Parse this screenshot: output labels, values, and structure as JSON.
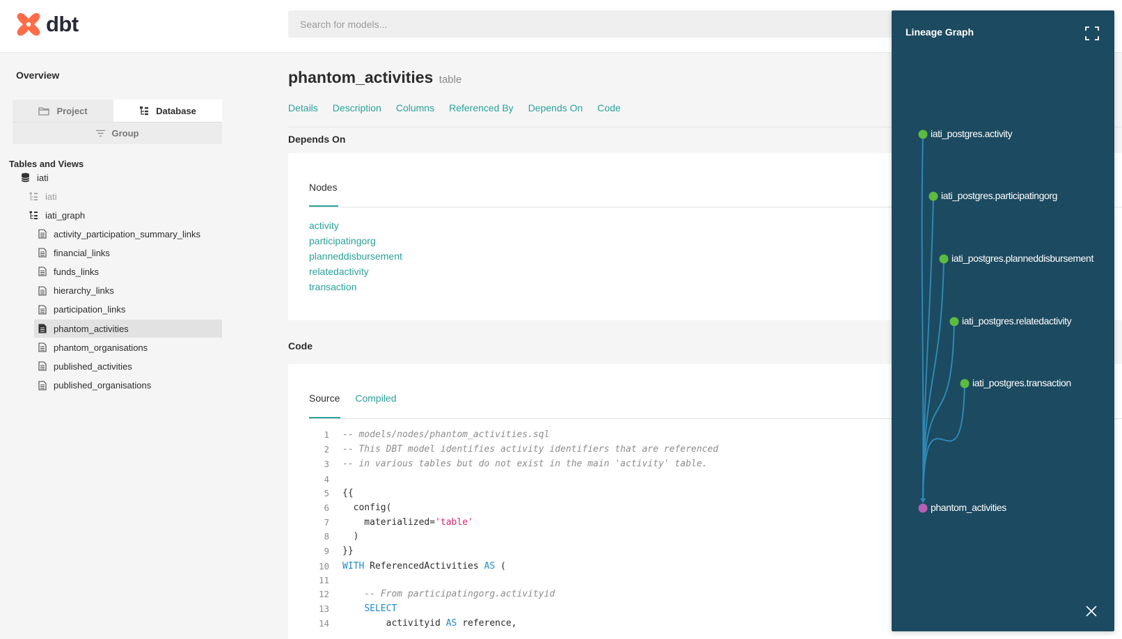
{
  "header": {
    "logo_text": "dbt",
    "search_placeholder": "Search for models..."
  },
  "sidebar": {
    "overview": "Overview",
    "switcher": {
      "project": "Project",
      "database": "Database",
      "group": "Group"
    },
    "tables_heading": "Tables and Views",
    "tree": {
      "db": "iati",
      "schema_iati": "iati",
      "schema_graph": "iati_graph",
      "items": [
        "activity_participation_summary_links",
        "financial_links",
        "funds_links",
        "hierarchy_links",
        "participation_links",
        "phantom_activities",
        "phantom_organisations",
        "published_activities",
        "published_organisations"
      ],
      "active_item": "phantom_activities"
    }
  },
  "main": {
    "title": "phantom_activities",
    "type": "table",
    "tabs": [
      "Details",
      "Description",
      "Columns",
      "Referenced By",
      "Depends On",
      "Code"
    ],
    "depends_heading": "Depends On",
    "nodes_label": "Nodes",
    "depends_nodes": [
      "activity",
      "participatingorg",
      "planneddisbursement",
      "relatedactivity",
      "transaction"
    ],
    "code_heading": "Code",
    "code_tabs": {
      "source": "Source",
      "compiled": "Compiled"
    },
    "code_lines": [
      {
        "n": "1",
        "parts": [
          {
            "t": "-- models/nodes/phantom_activities.sql",
            "k": "comment"
          }
        ]
      },
      {
        "n": "2",
        "parts": [
          {
            "t": "-- This DBT model identifies activity identifiers that are referenced",
            "k": "comment"
          }
        ]
      },
      {
        "n": "3",
        "parts": [
          {
            "t": "-- in various tables but do not exist in the main 'activity' table.",
            "k": "comment"
          }
        ]
      },
      {
        "n": "4",
        "parts": []
      },
      {
        "n": "5",
        "parts": [
          {
            "t": "{{",
            "k": ""
          }
        ]
      },
      {
        "n": "6",
        "parts": [
          {
            "t": "  config(",
            "k": ""
          }
        ]
      },
      {
        "n": "7",
        "parts": [
          {
            "t": "    materialized=",
            "k": ""
          },
          {
            "t": "'table'",
            "k": "str"
          }
        ]
      },
      {
        "n": "8",
        "parts": [
          {
            "t": "  )",
            "k": ""
          }
        ]
      },
      {
        "n": "9",
        "parts": [
          {
            "t": "}}",
            "k": ""
          }
        ]
      },
      {
        "n": "10",
        "parts": [
          {
            "t": "WITH",
            "k": "kw"
          },
          {
            "t": " ReferencedActivities ",
            "k": ""
          },
          {
            "t": "AS",
            "k": "kw"
          },
          {
            "t": " (",
            "k": ""
          }
        ]
      },
      {
        "n": "11",
        "parts": []
      },
      {
        "n": "12",
        "parts": [
          {
            "t": "    -- From participatingorg.activityid",
            "k": "comment"
          }
        ]
      },
      {
        "n": "13",
        "parts": [
          {
            "t": "    ",
            "k": ""
          },
          {
            "t": "SELECT",
            "k": "kw"
          }
        ]
      },
      {
        "n": "14",
        "parts": [
          {
            "t": "        activityid ",
            "k": ""
          },
          {
            "t": "AS",
            "k": "kw"
          },
          {
            "t": " reference,",
            "k": ""
          }
        ]
      }
    ]
  },
  "lineage": {
    "title": "Lineage Graph",
    "nodes": [
      {
        "label": "iati_postgres.activity",
        "kind": "source"
      },
      {
        "label": "iati_postgres.participatingorg",
        "kind": "source"
      },
      {
        "label": "iati_postgres.planneddisbursement",
        "kind": "source"
      },
      {
        "label": "iati_postgres.relatedactivity",
        "kind": "source"
      },
      {
        "label": "iati_postgres.transaction",
        "kind": "source"
      },
      {
        "label": "phantom_activities",
        "kind": "model"
      }
    ],
    "colors": {
      "panel": "#1c4a60",
      "source": "#5dbb3f",
      "model": "#b660b6",
      "edge": "#2e89b3"
    },
    "expand_icon": "expand-icon",
    "close_icon": "close-icon"
  }
}
